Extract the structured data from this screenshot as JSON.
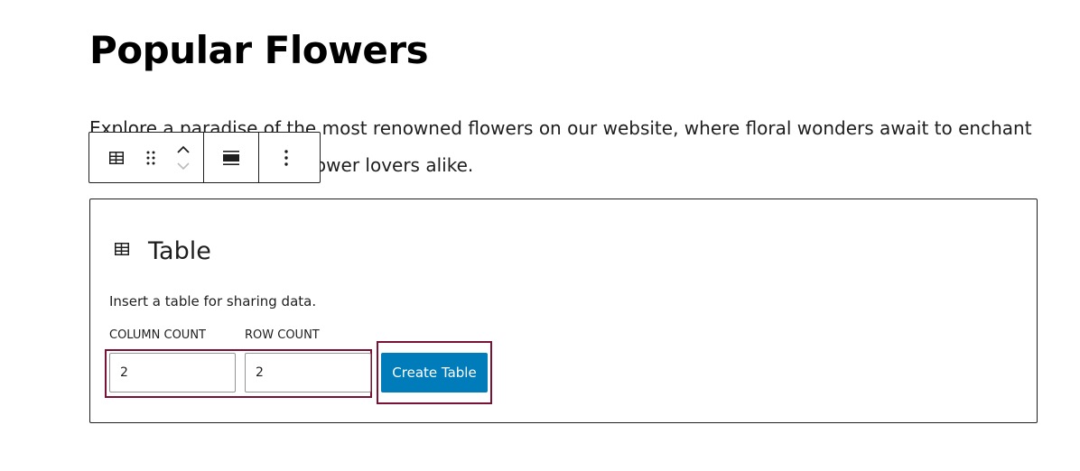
{
  "page": {
    "title": "Popular Flowers",
    "intro": "Explore a paradise of the most renowned flowers on our website, where floral wonders await to enchant nature enthusiasts and flower lovers alike."
  },
  "toolbar": {
    "icons": [
      "table-icon",
      "drag-handle-icon",
      "chevron-up-icon",
      "chevron-down-icon",
      "align-icon",
      "more-options-icon"
    ]
  },
  "table_block": {
    "title": "Table",
    "instructions": "Insert a table for sharing data.",
    "column_count_label": "COLUMN COUNT",
    "row_count_label": "ROW COUNT",
    "column_count_value": "2",
    "row_count_value": "2",
    "create_button_label": "Create Table"
  },
  "colors": {
    "primary_button": "#007cba",
    "highlight_frame": "#7a1236",
    "text": "#1e1e1e"
  }
}
